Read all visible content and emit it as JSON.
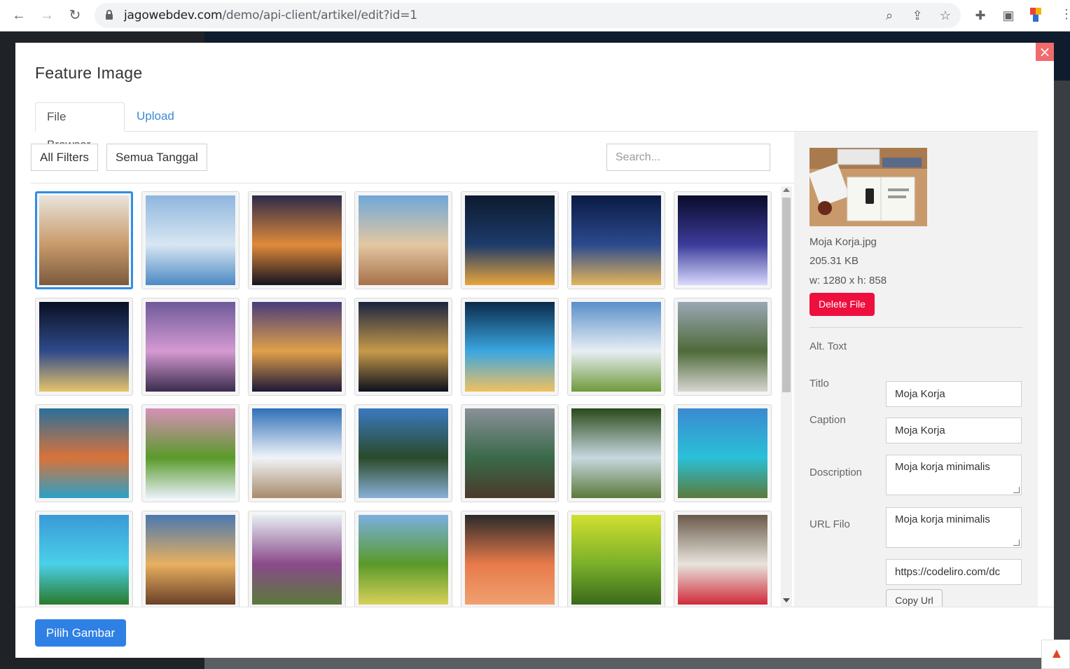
{
  "browser": {
    "url_host": "jagowebdev.com",
    "url_path": "/demo/api-client/artikel/edit?id=1",
    "back_icon": "←",
    "forward_icon": "→",
    "reload_icon": "↻",
    "zoom_icon": "⌕",
    "share_icon": "⇪",
    "star_icon": "☆",
    "extensions_icon": "✚",
    "sidepanel_icon": "▣",
    "menu_icon": "⋮"
  },
  "modal": {
    "title": "Feature Image",
    "close_label": "×",
    "tabs": [
      {
        "label": "File Browser"
      },
      {
        "label": "Upload"
      }
    ],
    "filters": {
      "all_filters": "All Filters",
      "date_filter": "Semua Tanggal",
      "search_placeholder": "Search..."
    },
    "thumbnails": [
      {
        "name": "workspace-desk",
        "colors": [
          "#e9e4dc",
          "#c89a6b",
          "#7a5a3e"
        ]
      },
      {
        "name": "futuristic-architecture",
        "colors": [
          "#8fb6df",
          "#d8e6f2",
          "#4c89c4"
        ]
      },
      {
        "name": "tower-bridge-sunset",
        "colors": [
          "#2c2a4a",
          "#e08a3a",
          "#141320"
        ]
      },
      {
        "name": "hillside-village",
        "colors": [
          "#6fa8d8",
          "#e3c7a2",
          "#a7714a"
        ]
      },
      {
        "name": "city-skyline-night",
        "colors": [
          "#0c1a2e",
          "#1d3b6b",
          "#e9a53b"
        ]
      },
      {
        "name": "canal-houses-night",
        "colors": [
          "#0a1a42",
          "#2b4a8f",
          "#e3b55a"
        ]
      },
      {
        "name": "ferris-wheel-night",
        "colors": [
          "#0a0a2a",
          "#3c3c9a",
          "#d9d9ff"
        ]
      },
      {
        "name": "bridge-interchange-night",
        "colors": [
          "#0a1022",
          "#2f4a8a",
          "#e6c46a"
        ]
      },
      {
        "name": "venice-canal-dusk",
        "colors": [
          "#6d5a9a",
          "#d59ad2",
          "#3a2c4e"
        ]
      },
      {
        "name": "castle-city-night",
        "colors": [
          "#4a3c7a",
          "#e0a04a",
          "#1c1838"
        ]
      },
      {
        "name": "twin-towers-night",
        "colors": [
          "#1a2440",
          "#c69a4a",
          "#0c101e"
        ]
      },
      {
        "name": "light-trails-city",
        "colors": [
          "#0a2a4a",
          "#3aa6e0",
          "#f0c060"
        ]
      },
      {
        "name": "alpine-village",
        "colors": [
          "#5a8fc9",
          "#e8eef4",
          "#6f9a3a"
        ]
      },
      {
        "name": "mountain-river",
        "colors": [
          "#9aa7b3",
          "#4f6a3a",
          "#d6d6d0"
        ]
      },
      {
        "name": "mountain-lake-reflection",
        "colors": [
          "#2a6f9a",
          "#d9733a",
          "#2aa0c8"
        ]
      },
      {
        "name": "waterfall-cliff",
        "colors": [
          "#d690b8",
          "#5a9a2a",
          "#e8f0f8"
        ]
      },
      {
        "name": "snowy-mountains",
        "colors": [
          "#2f6fb8",
          "#f0f4f8",
          "#a88a6a"
        ]
      },
      {
        "name": "lake-village",
        "colors": [
          "#3a7ac0",
          "#2a4a2a",
          "#8ab0d8"
        ]
      },
      {
        "name": "dolomites-lake",
        "colors": [
          "#8a9098",
          "#3a6a4a",
          "#4a3a2a"
        ]
      },
      {
        "name": "forest-stream",
        "colors": [
          "#2a4a1a",
          "#c8d8e0",
          "#5a7a3a"
        ]
      },
      {
        "name": "tropical-bungalows",
        "colors": [
          "#3a8ad0",
          "#2ac0d8",
          "#5a7a3a"
        ]
      },
      {
        "name": "tropical-island",
        "colors": [
          "#3a9ad8",
          "#4ad0e8",
          "#2a7a2a"
        ]
      },
      {
        "name": "wooden-pier-sunset",
        "colors": [
          "#4a78b0",
          "#e8b060",
          "#6a4028"
        ]
      },
      {
        "name": "snowy-peak-meadow",
        "colors": [
          "#e8eef4",
          "#8a4a8a",
          "#5a7a3a"
        ]
      },
      {
        "name": "green-meadow",
        "colors": [
          "#7ab0e0",
          "#5a9a2a",
          "#d8d05a"
        ]
      },
      {
        "name": "papaya-slices",
        "colors": [
          "#2a2a2a",
          "#e87a4a",
          "#f0a070"
        ]
      },
      {
        "name": "guava-fruits",
        "colors": [
          "#d0e030",
          "#7ab02a",
          "#3a6a1a"
        ]
      },
      {
        "name": "fruit-salad-bowls",
        "colors": [
          "#6a5a4a",
          "#e8e4dc",
          "#d02a3a"
        ]
      }
    ]
  },
  "details": {
    "filename": "Moja Korja.jpg",
    "filesize": "205.31 KB",
    "dimensions": "w: 1280 x h: 858",
    "delete_label": "Delete File",
    "fields": {
      "alt_label": "Alt. Toxt",
      "alt_value": "Moja Korja",
      "title_label": "Titlo",
      "title_value": "Moja Korja",
      "caption_label": "Caption",
      "caption_value": "Moja korja minimalis",
      "description_label": "Doscription",
      "description_value": "Moja korja minimalis",
      "url_label": "URL Filo",
      "url_value": "https://codeliro.com/dc"
    },
    "copy_label": "Copy Url"
  },
  "footer": {
    "select_label": "Pilih Gambar"
  },
  "colors": {
    "accent": "#2f80e4",
    "selected_border": "#2f8ee6",
    "danger": "#ee0f3f",
    "link": "#3a8bd6"
  }
}
